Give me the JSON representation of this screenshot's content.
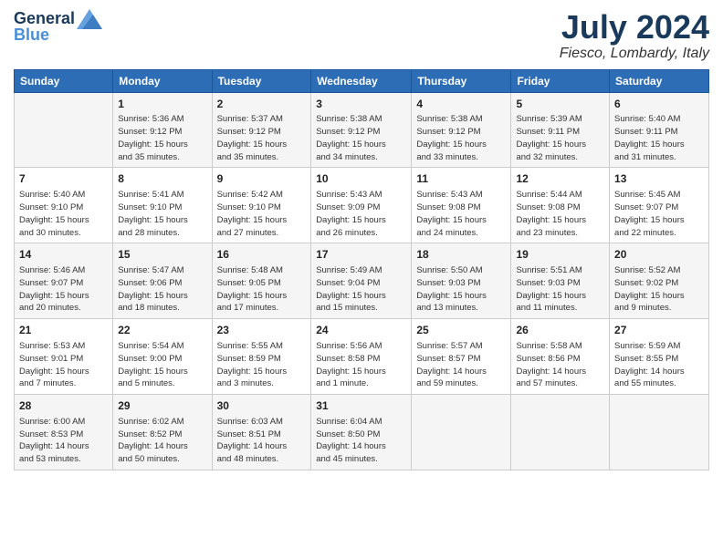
{
  "app": {
    "logo_line1": "General",
    "logo_line2": "Blue",
    "month_year": "July 2024",
    "location": "Fiesco, Lombardy, Italy"
  },
  "calendar": {
    "headers": [
      "Sunday",
      "Monday",
      "Tuesday",
      "Wednesday",
      "Thursday",
      "Friday",
      "Saturday"
    ],
    "weeks": [
      [
        {
          "day": "",
          "info": ""
        },
        {
          "day": "1",
          "info": "Sunrise: 5:36 AM\nSunset: 9:12 PM\nDaylight: 15 hours\nand 35 minutes."
        },
        {
          "day": "2",
          "info": "Sunrise: 5:37 AM\nSunset: 9:12 PM\nDaylight: 15 hours\nand 35 minutes."
        },
        {
          "day": "3",
          "info": "Sunrise: 5:38 AM\nSunset: 9:12 PM\nDaylight: 15 hours\nand 34 minutes."
        },
        {
          "day": "4",
          "info": "Sunrise: 5:38 AM\nSunset: 9:12 PM\nDaylight: 15 hours\nand 33 minutes."
        },
        {
          "day": "5",
          "info": "Sunrise: 5:39 AM\nSunset: 9:11 PM\nDaylight: 15 hours\nand 32 minutes."
        },
        {
          "day": "6",
          "info": "Sunrise: 5:40 AM\nSunset: 9:11 PM\nDaylight: 15 hours\nand 31 minutes."
        }
      ],
      [
        {
          "day": "7",
          "info": "Sunrise: 5:40 AM\nSunset: 9:10 PM\nDaylight: 15 hours\nand 30 minutes."
        },
        {
          "day": "8",
          "info": "Sunrise: 5:41 AM\nSunset: 9:10 PM\nDaylight: 15 hours\nand 28 minutes."
        },
        {
          "day": "9",
          "info": "Sunrise: 5:42 AM\nSunset: 9:10 PM\nDaylight: 15 hours\nand 27 minutes."
        },
        {
          "day": "10",
          "info": "Sunrise: 5:43 AM\nSunset: 9:09 PM\nDaylight: 15 hours\nand 26 minutes."
        },
        {
          "day": "11",
          "info": "Sunrise: 5:43 AM\nSunset: 9:08 PM\nDaylight: 15 hours\nand 24 minutes."
        },
        {
          "day": "12",
          "info": "Sunrise: 5:44 AM\nSunset: 9:08 PM\nDaylight: 15 hours\nand 23 minutes."
        },
        {
          "day": "13",
          "info": "Sunrise: 5:45 AM\nSunset: 9:07 PM\nDaylight: 15 hours\nand 22 minutes."
        }
      ],
      [
        {
          "day": "14",
          "info": "Sunrise: 5:46 AM\nSunset: 9:07 PM\nDaylight: 15 hours\nand 20 minutes."
        },
        {
          "day": "15",
          "info": "Sunrise: 5:47 AM\nSunset: 9:06 PM\nDaylight: 15 hours\nand 18 minutes."
        },
        {
          "day": "16",
          "info": "Sunrise: 5:48 AM\nSunset: 9:05 PM\nDaylight: 15 hours\nand 17 minutes."
        },
        {
          "day": "17",
          "info": "Sunrise: 5:49 AM\nSunset: 9:04 PM\nDaylight: 15 hours\nand 15 minutes."
        },
        {
          "day": "18",
          "info": "Sunrise: 5:50 AM\nSunset: 9:03 PM\nDaylight: 15 hours\nand 13 minutes."
        },
        {
          "day": "19",
          "info": "Sunrise: 5:51 AM\nSunset: 9:03 PM\nDaylight: 15 hours\nand 11 minutes."
        },
        {
          "day": "20",
          "info": "Sunrise: 5:52 AM\nSunset: 9:02 PM\nDaylight: 15 hours\nand 9 minutes."
        }
      ],
      [
        {
          "day": "21",
          "info": "Sunrise: 5:53 AM\nSunset: 9:01 PM\nDaylight: 15 hours\nand 7 minutes."
        },
        {
          "day": "22",
          "info": "Sunrise: 5:54 AM\nSunset: 9:00 PM\nDaylight: 15 hours\nand 5 minutes."
        },
        {
          "day": "23",
          "info": "Sunrise: 5:55 AM\nSunset: 8:59 PM\nDaylight: 15 hours\nand 3 minutes."
        },
        {
          "day": "24",
          "info": "Sunrise: 5:56 AM\nSunset: 8:58 PM\nDaylight: 15 hours\nand 1 minute."
        },
        {
          "day": "25",
          "info": "Sunrise: 5:57 AM\nSunset: 8:57 PM\nDaylight: 14 hours\nand 59 minutes."
        },
        {
          "day": "26",
          "info": "Sunrise: 5:58 AM\nSunset: 8:56 PM\nDaylight: 14 hours\nand 57 minutes."
        },
        {
          "day": "27",
          "info": "Sunrise: 5:59 AM\nSunset: 8:55 PM\nDaylight: 14 hours\nand 55 minutes."
        }
      ],
      [
        {
          "day": "28",
          "info": "Sunrise: 6:00 AM\nSunset: 8:53 PM\nDaylight: 14 hours\nand 53 minutes."
        },
        {
          "day": "29",
          "info": "Sunrise: 6:02 AM\nSunset: 8:52 PM\nDaylight: 14 hours\nand 50 minutes."
        },
        {
          "day": "30",
          "info": "Sunrise: 6:03 AM\nSunset: 8:51 PM\nDaylight: 14 hours\nand 48 minutes."
        },
        {
          "day": "31",
          "info": "Sunrise: 6:04 AM\nSunset: 8:50 PM\nDaylight: 14 hours\nand 45 minutes."
        },
        {
          "day": "",
          "info": ""
        },
        {
          "day": "",
          "info": ""
        },
        {
          "day": "",
          "info": ""
        }
      ]
    ]
  }
}
